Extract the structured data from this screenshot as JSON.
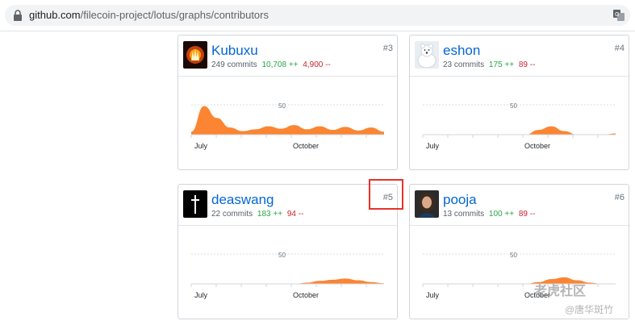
{
  "browser": {
    "url_host": "github.com",
    "url_path": "/filecoin-project/lotus/graphs/contributors"
  },
  "contributors": [
    {
      "login": "Kubuxu",
      "commits": "249 commits",
      "additions": "10,708 ++",
      "deletions": "4,900 --",
      "rank": "#3",
      "avatar": "flaming-hand-avatar"
    },
    {
      "login": "eshon",
      "commits": "23 commits",
      "additions": "175 ++",
      "deletions": "89 --",
      "rank": "#4",
      "avatar": "polar-bear-avatar"
    },
    {
      "login": "deaswang",
      "commits": "22 commits",
      "additions": "183 ++",
      "deletions": "94 --",
      "rank": "#5",
      "avatar": "cross-avatar"
    },
    {
      "login": "pooja",
      "commits": "13 commits",
      "additions": "100 ++",
      "deletions": "89 --",
      "rank": "#6",
      "avatar": "portrait-avatar"
    }
  ],
  "graph": {
    "y_tick": "50",
    "x_labels": [
      "July",
      "October"
    ],
    "area_color": "#fb8532"
  },
  "watermark": {
    "line1": "老虎社区",
    "line2": "@唐华斑竹"
  },
  "chart_data": [
    {
      "type": "area",
      "series": [
        {
          "name": "Kubuxu",
          "values": [
            5,
            48,
            28,
            12,
            6,
            9,
            14,
            10,
            16,
            9,
            14,
            8,
            13,
            7,
            12,
            5
          ]
        }
      ],
      "y_ticks": [
        50
      ],
      "x_tick_labels": [
        "July",
        "October"
      ]
    },
    {
      "type": "area",
      "series": [
        {
          "name": "eshon",
          "values": [
            0,
            0,
            0,
            0,
            0,
            0,
            0,
            0,
            0,
            8,
            14,
            6,
            0,
            0,
            0,
            2
          ]
        }
      ],
      "y_ticks": [
        50
      ],
      "x_tick_labels": [
        "July",
        "October"
      ]
    },
    {
      "type": "area",
      "series": [
        {
          "name": "deaswang",
          "values": [
            0,
            0,
            0,
            0,
            0,
            0,
            0,
            0,
            0,
            2,
            5,
            7,
            9,
            6,
            3,
            1
          ]
        }
      ],
      "y_ticks": [
        50
      ],
      "x_tick_labels": [
        "July",
        "October"
      ]
    },
    {
      "type": "area",
      "series": [
        {
          "name": "pooja",
          "values": [
            0,
            0,
            0,
            0,
            0,
            0,
            0,
            0,
            0,
            3,
            8,
            11,
            6,
            2,
            0,
            0
          ]
        }
      ],
      "y_ticks": [
        50
      ],
      "x_tick_labels": [
        "July",
        "October"
      ]
    }
  ]
}
